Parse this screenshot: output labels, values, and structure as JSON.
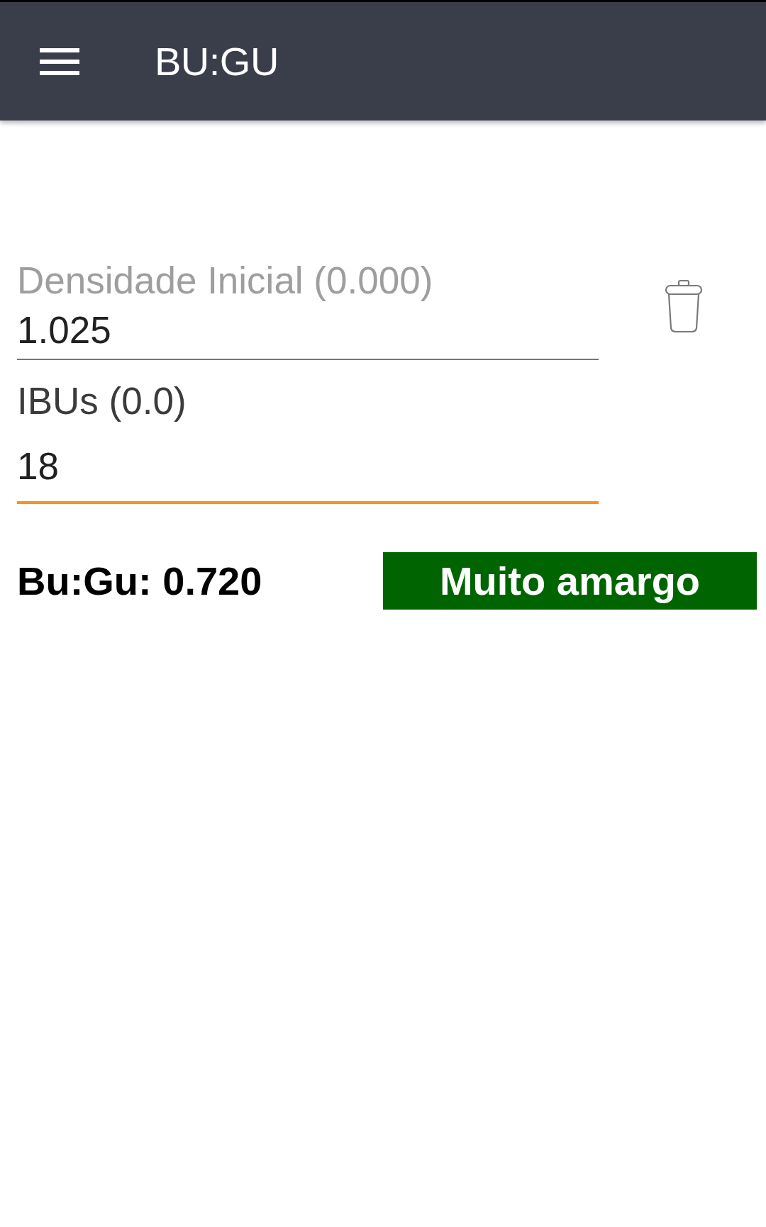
{
  "app_bar": {
    "title": "BU:GU"
  },
  "fields": [
    {
      "kind": "floating",
      "label": "Densidade Inicial (0.000)",
      "value": "1.025",
      "focused": false
    },
    {
      "kind": "stacked",
      "label": "IBUs (0.0)",
      "value": "18",
      "focused": true
    }
  ],
  "result": {
    "text": "Bu:Gu: 0.720",
    "rating": "Muito amargo"
  }
}
